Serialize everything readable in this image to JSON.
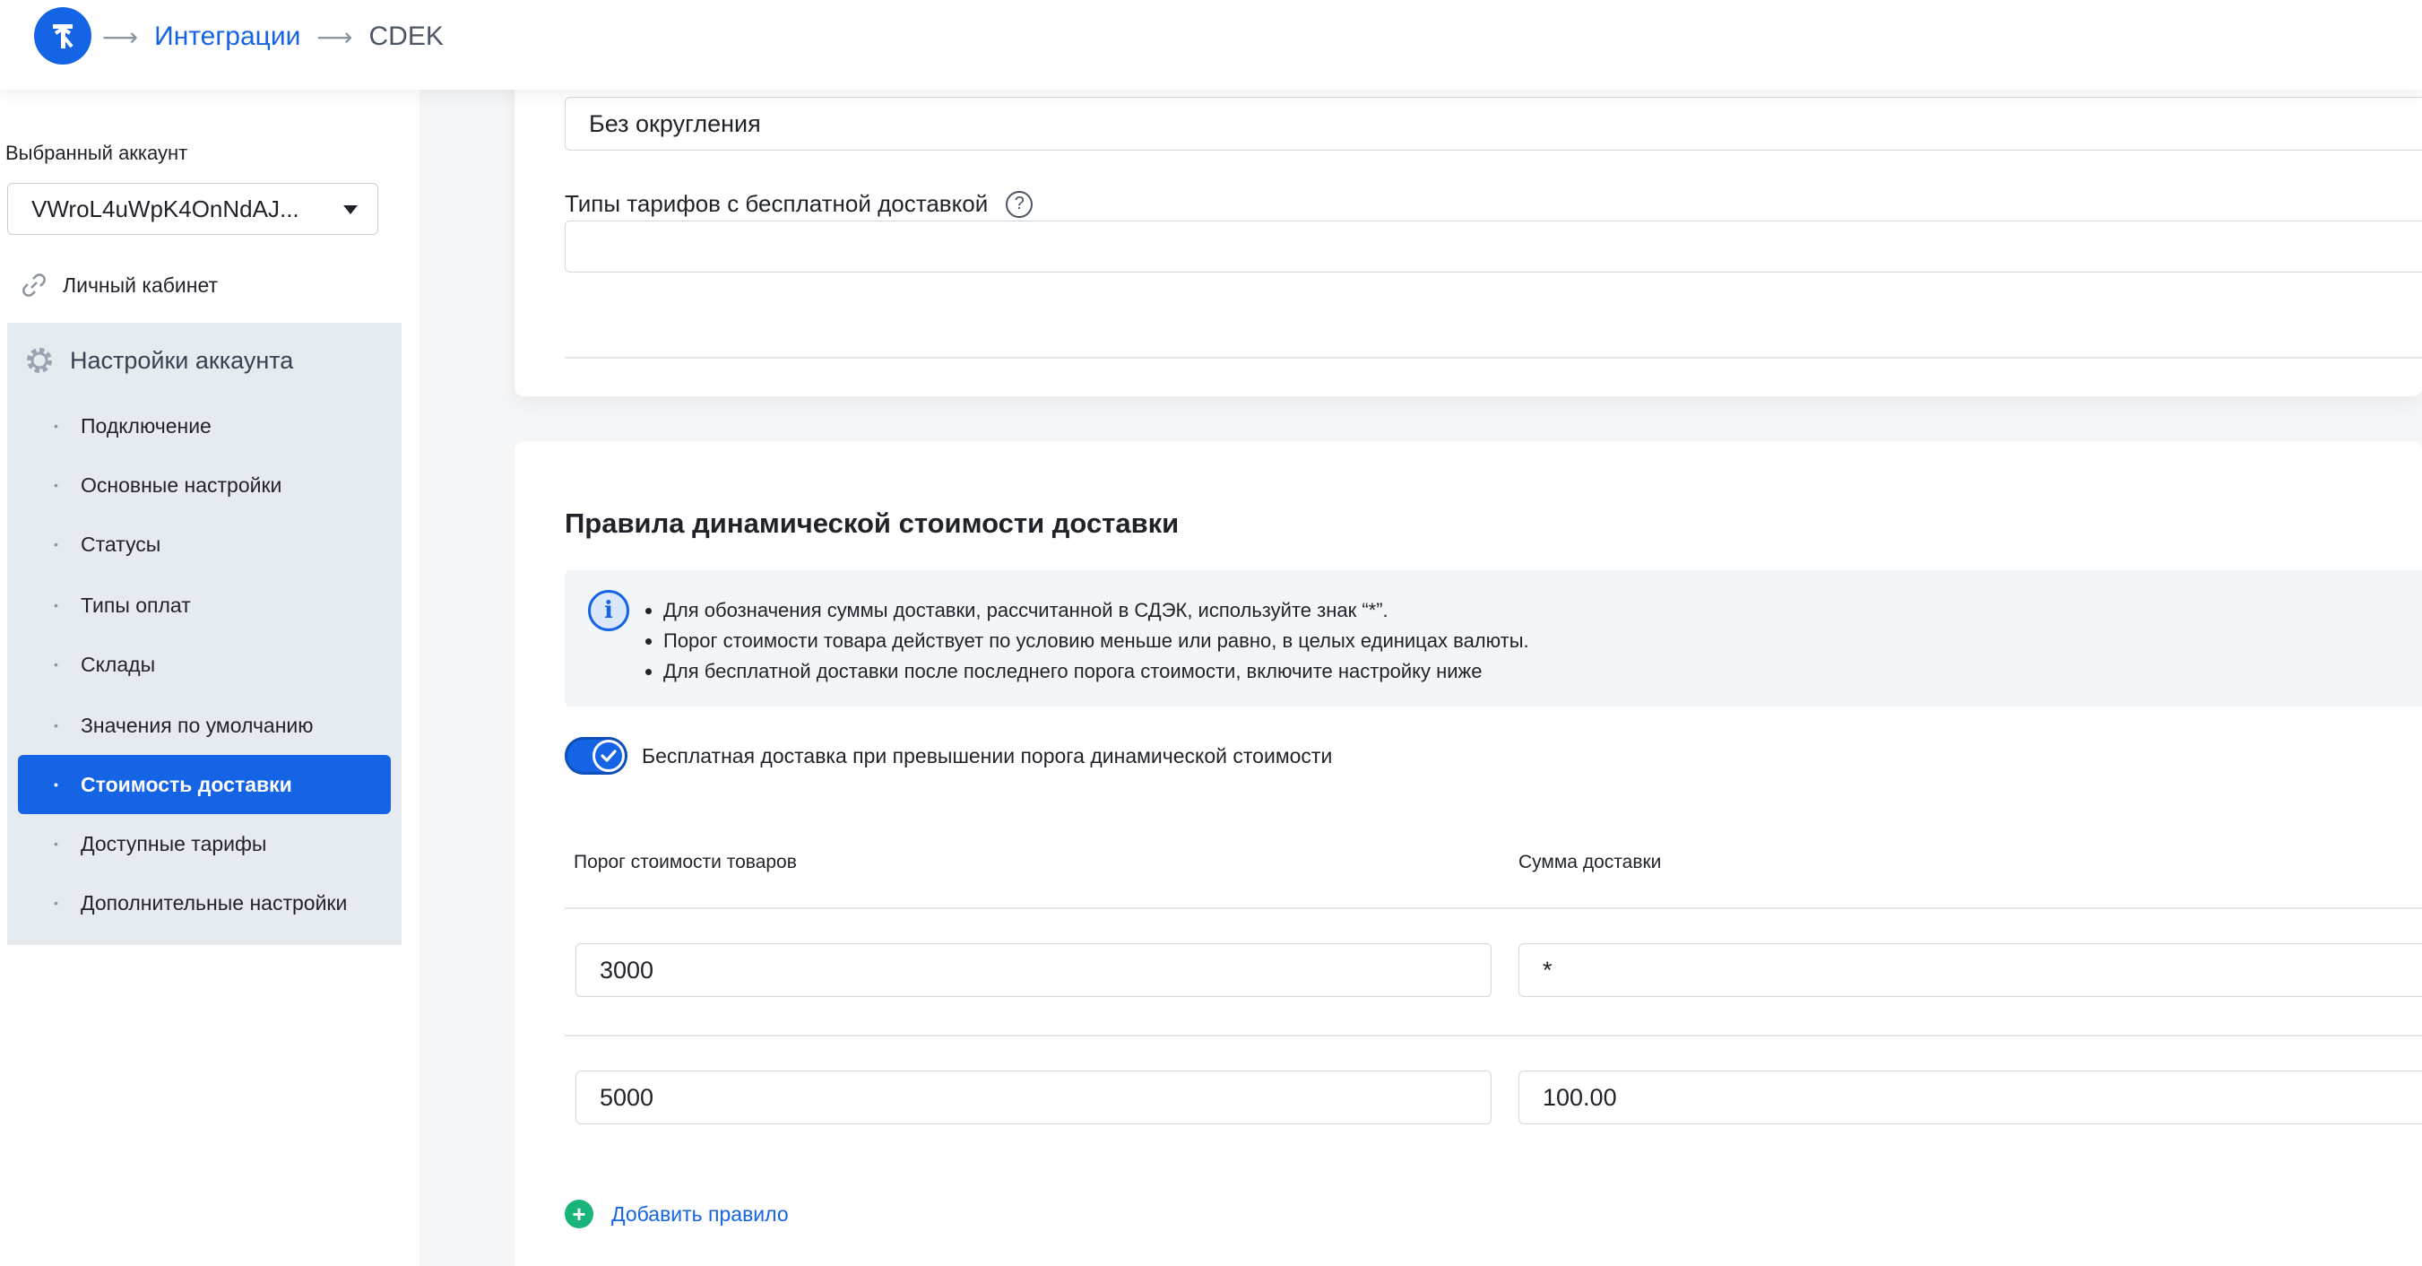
{
  "header": {
    "breadcrumb": [
      {
        "label": "Интеграции"
      },
      {
        "label": "CDEK"
      }
    ],
    "logo_color": "#1664e6"
  },
  "sidebar": {
    "account_label": "Выбранный аккаунт",
    "account_value": "VWroL4uWpK4OnNdAJ...",
    "cabinet_label": "Личный кабинет",
    "group_title": "Настройки аккаунта",
    "items": [
      {
        "label": "Подключение"
      },
      {
        "label": "Основные настройки"
      },
      {
        "label": "Статусы"
      },
      {
        "label": "Типы оплат"
      },
      {
        "label": "Склады"
      },
      {
        "label": "Значения по умолчанию"
      },
      {
        "label": "Стоимость доставки",
        "active": true
      },
      {
        "label": "Доступные тарифы"
      },
      {
        "label": "Дополнительные настройки"
      }
    ]
  },
  "top_card": {
    "rounding_value": "Без округления",
    "free_tariffs_label": "Типы тарифов с бесплатной доставкой",
    "free_tariffs_value": ""
  },
  "rules_card": {
    "title": "Правила динамической стоимости доставки",
    "info_lines": [
      "Для обозначения суммы доставки, рассчитанной в СДЭК, используйте знак “*”.",
      "Порог стоимости товара действует по условию меньше или равно, в целых единицах валюты.",
      "Для бесплатной доставки после последнего порога стоимости, включите настройку ниже"
    ],
    "toggle_label": "Бесплатная доставка при превышении порога динамической стоимости",
    "toggle_on": true,
    "col_threshold": "Порог стоимости товаров",
    "col_amount": "Сумма доставки",
    "rows": [
      {
        "threshold": "3000",
        "amount": "*"
      },
      {
        "threshold": "5000",
        "amount": "100.00"
      }
    ],
    "add_rule_label": "Добавить правило"
  }
}
